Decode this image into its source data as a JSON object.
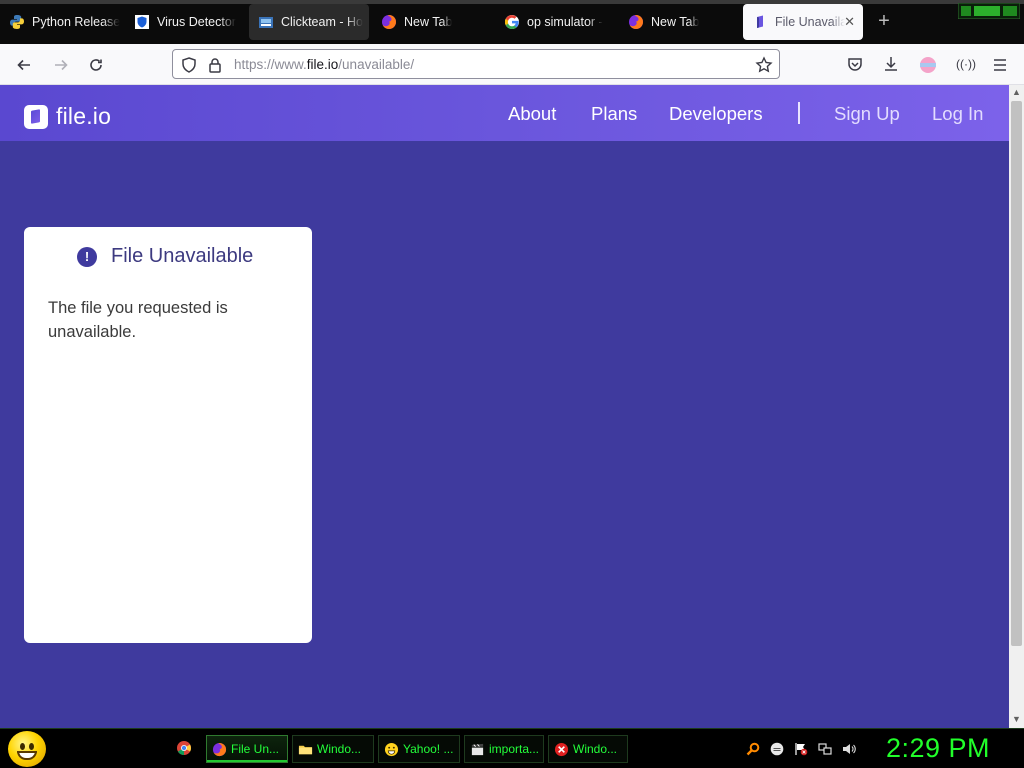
{
  "browser": {
    "tabs": [
      {
        "label": "Python Release",
        "icon": "python-icon"
      },
      {
        "label": "Virus Detector",
        "icon": "shield-icon"
      },
      {
        "label": "Clickteam - Ho",
        "icon": "clickteam-icon"
      },
      {
        "label": "New Tab",
        "icon": "firefox-icon"
      },
      {
        "label": "op simulator -",
        "icon": "google-icon"
      },
      {
        "label": "New Tab",
        "icon": "firefox-icon"
      },
      {
        "label": "File Unavaila",
        "icon": "fileio-icon",
        "active": true
      }
    ],
    "url": {
      "prefix": "https://www.",
      "domain": "file.io",
      "path": "/unavailable/"
    }
  },
  "site": {
    "brand": "file.io",
    "nav": {
      "about": "About",
      "plans": "Plans",
      "developers": "Developers",
      "signup": "Sign Up",
      "login": "Log In"
    },
    "card": {
      "title": "File Unavailable",
      "message": "The file you requested is unavailable.",
      "icon": "exclamation-circle-icon"
    },
    "colors": {
      "page_bg": "#3f3a9e",
      "header_start": "#5a48d0",
      "header_end": "#7c62ea"
    }
  },
  "taskbar": {
    "buttons": [
      {
        "label": "File Un...",
        "icon": "firefox-icon",
        "active": true
      },
      {
        "label": "Windo...",
        "icon": "folder-icon"
      },
      {
        "label": "Yahoo! ...",
        "icon": "smiley-icon"
      },
      {
        "label": "importa...",
        "icon": "clapperboard-icon"
      },
      {
        "label": "Windo...",
        "icon": "error-icon"
      }
    ],
    "clock": "2:29 PM",
    "text_color": "#23ff3a"
  }
}
